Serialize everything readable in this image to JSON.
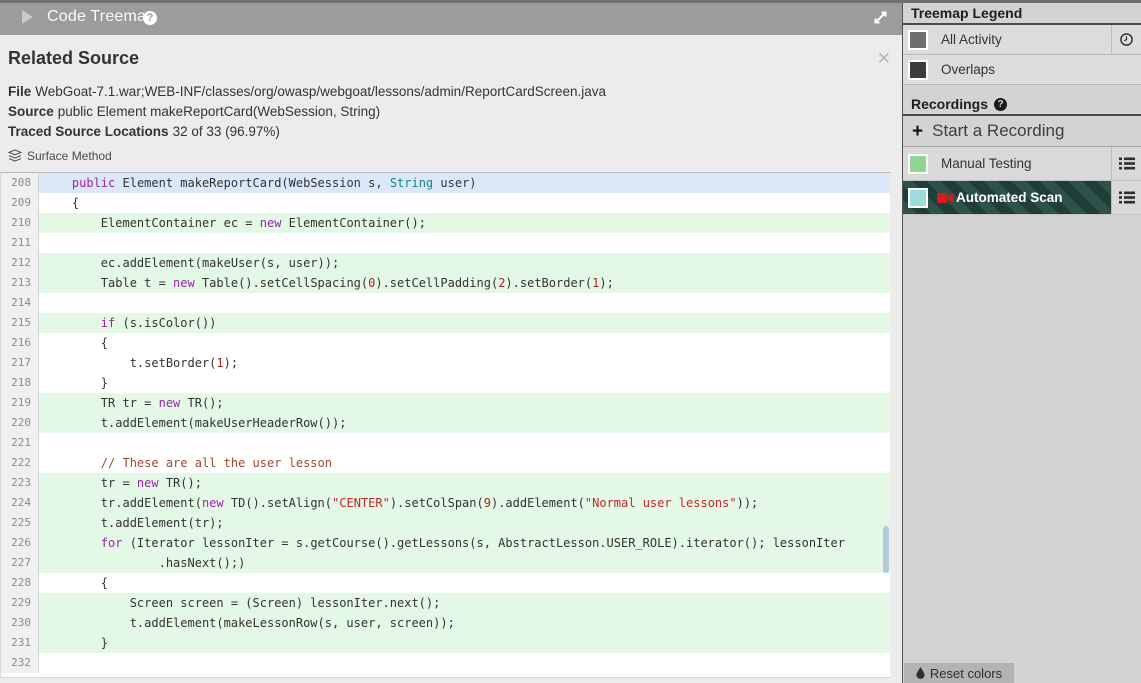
{
  "header": {
    "title": "Code Treemap",
    "help_glyph": "?"
  },
  "panel": {
    "title": "Related Source",
    "close_glyph": "✕",
    "meta": [
      {
        "label": "File",
        "value": "WebGoat-7.1.war;WEB-INF/classes/org/owasp/webgoat/lessons/admin/ReportCardScreen.java"
      },
      {
        "label": "Source",
        "value": "public Element makeReportCard(WebSession, String)"
      },
      {
        "label": "Traced Source Locations",
        "value": "32 of 33 (96.97%)"
      }
    ],
    "surface_method_label": "Surface Method"
  },
  "code": {
    "lines": [
      {
        "n": 208,
        "hl": "blue",
        "seg": [
          [
            "    ",
            ""
          ],
          [
            "public",
            "kw"
          ],
          [
            " Element makeReportCard(WebSession s, ",
            ""
          ],
          [
            "String",
            "typ"
          ],
          [
            " user)",
            ""
          ]
        ]
      },
      {
        "n": 209,
        "hl": "",
        "seg": [
          [
            "    {",
            ""
          ]
        ]
      },
      {
        "n": 210,
        "hl": "green",
        "seg": [
          [
            "        ElementContainer ec = ",
            ""
          ],
          [
            "new",
            "kw"
          ],
          [
            " ElementContainer();",
            ""
          ]
        ]
      },
      {
        "n": 211,
        "hl": "",
        "seg": [
          [
            "",
            ""
          ]
        ]
      },
      {
        "n": 212,
        "hl": "green",
        "seg": [
          [
            "        ec.addElement(makeUser(s, user));",
            ""
          ]
        ]
      },
      {
        "n": 213,
        "hl": "green",
        "seg": [
          [
            "        Table t = ",
            ""
          ],
          [
            "new",
            "kw"
          ],
          [
            " Table().setCellSpacing(",
            ""
          ],
          [
            "0",
            "num"
          ],
          [
            ").setCellPadding(",
            ""
          ],
          [
            "2",
            "num"
          ],
          [
            ").setBorder(",
            ""
          ],
          [
            "1",
            "num"
          ],
          [
            ");",
            ""
          ]
        ]
      },
      {
        "n": 214,
        "hl": "",
        "seg": [
          [
            "",
            ""
          ]
        ]
      },
      {
        "n": 215,
        "hl": "green",
        "seg": [
          [
            "        ",
            ""
          ],
          [
            "if",
            "kw"
          ],
          [
            " (s.isColor())",
            ""
          ]
        ]
      },
      {
        "n": 216,
        "hl": "",
        "seg": [
          [
            "        {",
            ""
          ]
        ]
      },
      {
        "n": 217,
        "hl": "",
        "seg": [
          [
            "            t.setBorder(",
            ""
          ],
          [
            "1",
            "num"
          ],
          [
            ");",
            ""
          ]
        ]
      },
      {
        "n": 218,
        "hl": "",
        "seg": [
          [
            "        }",
            ""
          ]
        ]
      },
      {
        "n": 219,
        "hl": "green",
        "seg": [
          [
            "        TR tr = ",
            ""
          ],
          [
            "new",
            "kw"
          ],
          [
            " TR();",
            ""
          ]
        ]
      },
      {
        "n": 220,
        "hl": "green",
        "seg": [
          [
            "        t.addElement(makeUserHeaderRow());",
            ""
          ]
        ]
      },
      {
        "n": 221,
        "hl": "",
        "seg": [
          [
            "",
            ""
          ]
        ]
      },
      {
        "n": 222,
        "hl": "",
        "seg": [
          [
            "        ",
            ""
          ],
          [
            "// These are all the user lesson",
            "com"
          ]
        ]
      },
      {
        "n": 223,
        "hl": "green",
        "seg": [
          [
            "        tr = ",
            ""
          ],
          [
            "new",
            "kw"
          ],
          [
            " TR();",
            ""
          ]
        ]
      },
      {
        "n": 224,
        "hl": "green",
        "seg": [
          [
            "        tr.addElement(",
            ""
          ],
          [
            "new",
            "kw"
          ],
          [
            " TD().setAlign(",
            ""
          ],
          [
            "\"CENTER\"",
            "str"
          ],
          [
            ").setColSpan(",
            ""
          ],
          [
            "9",
            "num"
          ],
          [
            ").addElement(",
            ""
          ],
          [
            "\"Normal user lessons\"",
            "str"
          ],
          [
            "));",
            ""
          ]
        ]
      },
      {
        "n": 225,
        "hl": "green",
        "seg": [
          [
            "        t.addElement(tr);",
            ""
          ]
        ]
      },
      {
        "n": 226,
        "hl": "green",
        "seg": [
          [
            "        ",
            ""
          ],
          [
            "for",
            "kw"
          ],
          [
            " (Iterator lessonIter = s.getCourse().getLessons(s, AbstractLesson.USER_ROLE).iterator(); lessonIter",
            ""
          ]
        ]
      },
      {
        "n": 227,
        "hl": "green",
        "seg": [
          [
            "                .hasNext();)",
            ""
          ]
        ]
      },
      {
        "n": 228,
        "hl": "",
        "seg": [
          [
            "        {",
            ""
          ]
        ]
      },
      {
        "n": 229,
        "hl": "green",
        "seg": [
          [
            "            Screen screen = (Screen) lessonIter.next();",
            ""
          ]
        ]
      },
      {
        "n": 230,
        "hl": "green",
        "seg": [
          [
            "            t.addElement(makeLessonRow(s, user, screen));",
            ""
          ]
        ]
      },
      {
        "n": 231,
        "hl": "green",
        "seg": [
          [
            "        }",
            ""
          ]
        ]
      },
      {
        "n": 232,
        "hl": "",
        "seg": [
          [
            "",
            ""
          ]
        ]
      }
    ]
  },
  "sidebar": {
    "legend": {
      "title": "Treemap Legend",
      "items": [
        {
          "label": "All Activity",
          "swatch": "#6e6e6e"
        },
        {
          "label": "Overlaps",
          "swatch": "#3b3b3b"
        }
      ]
    },
    "recordings": {
      "title": "Recordings",
      "help_glyph": "?",
      "plus_glyph": "+",
      "start_label": "Start a Recording",
      "items": [
        {
          "label": "Manual Testing",
          "swatch": "#8fd694",
          "selected": false
        },
        {
          "label": "Automated Scan",
          "swatch": "#9edcda",
          "selected": true
        }
      ]
    },
    "reset_label": "Reset colors"
  },
  "colors": {
    "highlight_line_blue": "#dbe8f9",
    "highlight_line_green": "#e4f8e6",
    "selected_stripe_a": "#2d524b",
    "selected_stripe_b": "#203d38",
    "syntax_keyword": "#9b26a6",
    "syntax_type": "#16867c",
    "syntax_string": "#c0282d",
    "syntax_comment": "#9e4a30",
    "syntax_number": "#9e2927"
  }
}
